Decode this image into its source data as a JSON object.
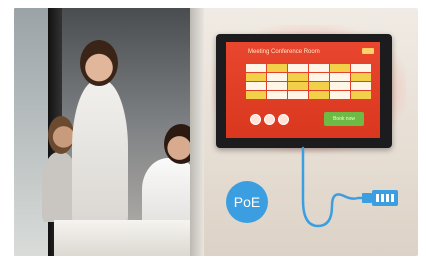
{
  "scene": {
    "description_icons": [
      "office-photo",
      "wall-touch-panel",
      "ethernet-connector"
    ],
    "panel": {
      "title": "Meeting Conference Room",
      "book_label": "Book now"
    },
    "badge": {
      "label": "PoE"
    }
  },
  "colors": {
    "screen_red": "#e8462e",
    "cable_blue": "#3b9ee0",
    "book_green": "#6dbb45",
    "slot_yellow": "#f2d04a",
    "slot_white": "#fff6e8"
  }
}
